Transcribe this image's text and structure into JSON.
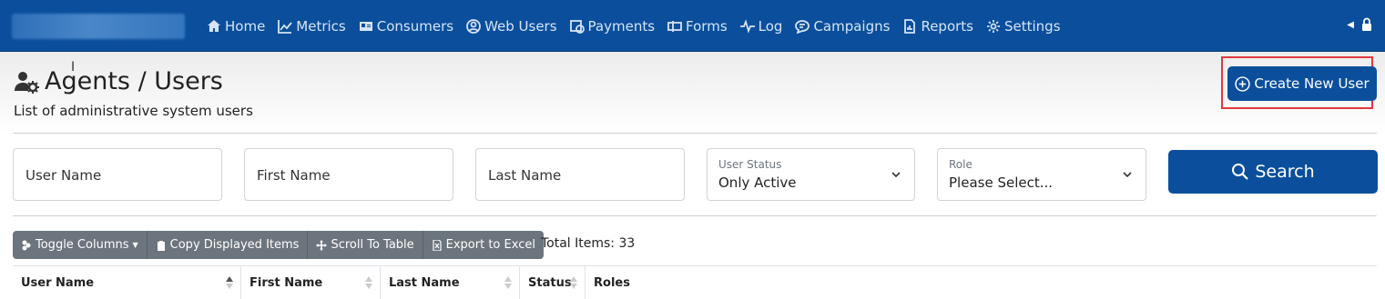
{
  "nav": {
    "items": [
      {
        "label": "Home",
        "icon": "home-icon"
      },
      {
        "label": "Metrics",
        "icon": "chart-icon"
      },
      {
        "label": "Consumers",
        "icon": "id-card-icon"
      },
      {
        "label": "Web Users",
        "icon": "user-circle-icon"
      },
      {
        "label": "Payments",
        "icon": "payments-icon"
      },
      {
        "label": "Forms",
        "icon": "forms-icon"
      },
      {
        "label": "Log",
        "icon": "pulse-icon"
      },
      {
        "label": "Campaigns",
        "icon": "chat-icon"
      },
      {
        "label": "Reports",
        "icon": "report-icon"
      },
      {
        "label": "Settings",
        "icon": "gear-icon"
      }
    ]
  },
  "page": {
    "title": "Agents / Users",
    "subtitle": "List of administrative system users",
    "create_label": "Create New User"
  },
  "filters": {
    "username_placeholder": "User Name",
    "firstname_placeholder": "First Name",
    "lastname_placeholder": "Last Name",
    "status_label": "User Status",
    "status_value": "Only Active",
    "role_label": "Role",
    "role_value": "Please Select...",
    "search_label": "Search"
  },
  "toolbar": {
    "toggle_columns": "Toggle Columns",
    "copy_items": "Copy Displayed Items",
    "scroll_table": "Scroll To Table",
    "export_excel": "Export to Excel",
    "total_items": "Total Items: 33"
  },
  "table": {
    "columns": [
      "User Name",
      "First Name",
      "Last Name",
      "Status",
      "Roles"
    ]
  },
  "colors": {
    "brand": "#0b4f9c",
    "highlight": "#e0393e",
    "toolbar": "#6c757d"
  }
}
